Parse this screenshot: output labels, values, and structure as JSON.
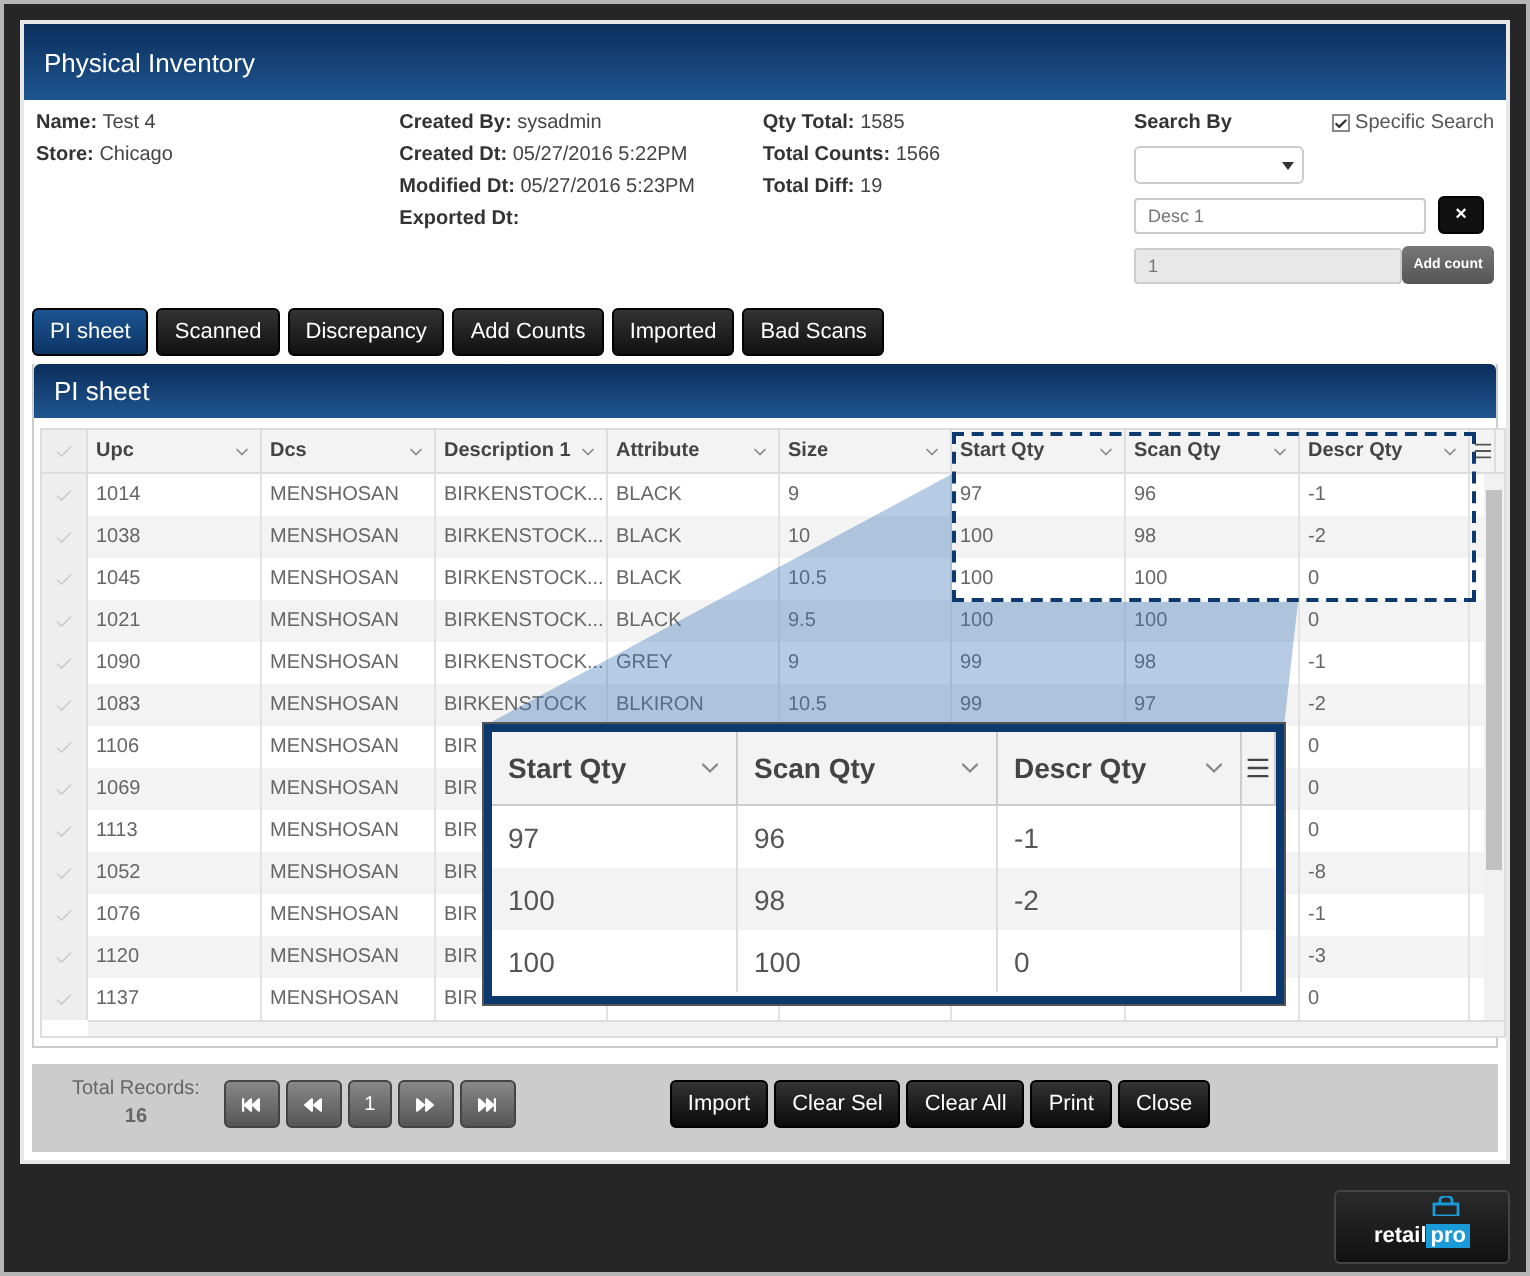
{
  "window": {
    "title": "Physical Inventory"
  },
  "info_columns": [
    [
      {
        "label": "Name:",
        "value": "Test 4"
      },
      {
        "label": "Store:",
        "value": "Chicago"
      }
    ],
    [
      {
        "label": "Created By:",
        "value": "sysadmin"
      },
      {
        "label": "Created Dt:",
        "value": "05/27/2016 5:22PM"
      },
      {
        "label": "Modified Dt:",
        "value": "05/27/2016 5:23PM"
      },
      {
        "label": "Exported Dt:"
      }
    ],
    [
      {
        "label": "Qty Total:",
        "value": "1585"
      },
      {
        "label": "Total Counts:",
        "value": "1566"
      },
      {
        "label": "Total Diff:",
        "value": "19"
      }
    ]
  ],
  "search": {
    "label": "Search By",
    "specific_search": {
      "label": "Specific Search",
      "checked": true
    },
    "text_placeholder": "Desc 1",
    "clear_button": "×",
    "count_value": "1",
    "add_count_button": "Add count"
  },
  "tabs": [
    {
      "label": "PI sheet",
      "selected": true
    },
    {
      "label": "Scanned",
      "selected": false
    },
    {
      "label": "Discrepancy",
      "selected": false
    },
    {
      "label": "Add Counts",
      "selected": false
    },
    {
      "label": "Imported",
      "selected": false
    },
    {
      "label": "Bad Scans",
      "selected": false
    }
  ],
  "panel_title": "PI sheet",
  "table": {
    "columns": [
      "Upc",
      "Dcs",
      "Description 1",
      "Attribute",
      "Size",
      "Start Qty",
      "Scan Qty",
      "Descr Qty"
    ],
    "rows": [
      [
        "1014",
        "MENSHOSAN",
        "BIRKENSTOCK...",
        "BLACK",
        "9",
        "97",
        "96",
        "-1"
      ],
      [
        "1038",
        "MENSHOSAN",
        "BIRKENSTOCK...",
        "BLACK",
        "10",
        "100",
        "98",
        "-2"
      ],
      [
        "1045",
        "MENSHOSAN",
        "BIRKENSTOCK...",
        "BLACK",
        "10.5",
        "100",
        "100",
        "0"
      ],
      [
        "1021",
        "MENSHOSAN",
        "BIRKENSTOCK...",
        "BLACK",
        "9.5",
        "100",
        "100",
        "0"
      ],
      [
        "1090",
        "MENSHOSAN",
        "BIRKENSTOCK...",
        "GREY",
        "9",
        "99",
        "98",
        "-1"
      ],
      [
        "1083",
        "MENSHOSAN",
        "BIRKENSTOCK",
        "BLKIRON",
        "10.5",
        "99",
        "97",
        "-2"
      ],
      [
        "1106",
        "MENSHOSAN",
        "BIR",
        null,
        null,
        null,
        null,
        "0"
      ],
      [
        "1069",
        "MENSHOSAN",
        "BIR",
        null,
        null,
        null,
        null,
        "0"
      ],
      [
        "1113",
        "MENSHOSAN",
        "BIR",
        null,
        null,
        null,
        null,
        "0"
      ],
      [
        "1052",
        "MENSHOSAN",
        "BIR",
        null,
        null,
        null,
        null,
        "-8"
      ],
      [
        "1076",
        "MENSHOSAN",
        "BIR",
        null,
        null,
        null,
        null,
        "-1"
      ],
      [
        "1120",
        "MENSHOSAN",
        "BIR",
        null,
        null,
        null,
        null,
        "-3"
      ],
      [
        "1137",
        "MENSHOSAN",
        "BIR",
        null,
        null,
        null,
        null,
        "0"
      ]
    ]
  },
  "zoom_callout": {
    "columns": [
      "Start Qty",
      "Scan Qty",
      "Descr Qty"
    ],
    "rows": [
      [
        "97",
        "96",
        "-1"
      ],
      [
        "100",
        "98",
        "-2"
      ],
      [
        "100",
        "100",
        "0"
      ]
    ]
  },
  "footer": {
    "total_label": "Total Records:",
    "total_value": "16",
    "page": "1",
    "buttons": [
      "Import",
      "Clear Sel",
      "Clear All",
      "Print",
      "Close"
    ]
  },
  "logo": {
    "part_1": "retail",
    "part_2": "pro"
  }
}
